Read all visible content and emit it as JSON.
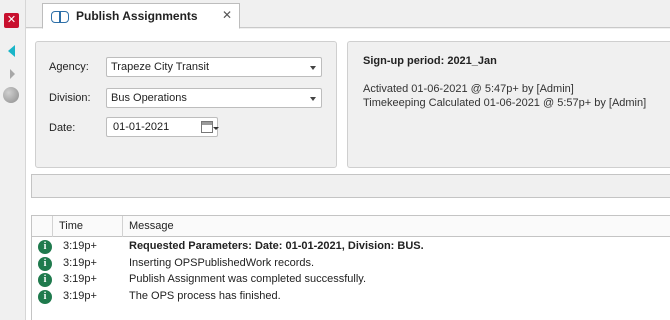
{
  "tab": {
    "label": "Publish Assignments",
    "close": "✕"
  },
  "form": {
    "agency_label": "Agency:",
    "agency_value": "Trapeze City Transit",
    "division_label": "Division:",
    "division_value": "Bus Operations",
    "date_label": "Date:",
    "date_value": "01-01-2021"
  },
  "signup": {
    "title": "Sign-up period: 2021_Jan",
    "activated": "Activated 01-06-2021 @  5:47p+ by [Admin]",
    "timekeeping": "Timekeeping Calculated 01-06-2021 @  5:57p+ by [Admin]"
  },
  "log": {
    "columns": [
      "Time",
      "Message"
    ],
    "rows": [
      {
        "time": "3:19p+",
        "message": "Requested Parameters: Date: 01-01-2021, Division: BUS.",
        "bold": true
      },
      {
        "time": "3:19p+",
        "message": "Inserting OPSPublishedWork records.",
        "bold": false
      },
      {
        "time": "3:19p+",
        "message": "Publish Assignment was completed successfully.",
        "bold": false
      },
      {
        "time": "3:19p+",
        "message": "The OPS process has finished.",
        "bold": false
      }
    ]
  },
  "icons": {
    "close": "close-icon",
    "nav_back": "arrow-left-icon",
    "nav_forward": "arrow-right-icon",
    "globe": "globe-icon",
    "tab": "book-icon",
    "calendar": "calendar-icon",
    "info": "info-icon"
  },
  "colors": {
    "close_red": "#c8102e",
    "arrow_teal": "#19b5c8",
    "info_green": "#1f7a4d"
  }
}
